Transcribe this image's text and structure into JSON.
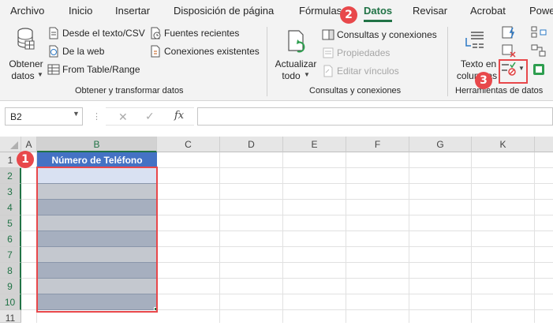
{
  "menu": {
    "tabs": [
      "Archivo",
      "Inicio",
      "Insertar",
      "Disposición de página",
      "Fórmulas",
      "Datos",
      "Revisar",
      "Acrobat",
      "Powe"
    ],
    "active_tab": "Datos"
  },
  "ribbon": {
    "get_transform": {
      "get_data_label": "Obtener",
      "get_data_label2": "datos",
      "from_text": "Desde el texto/CSV",
      "from_web": "De la web",
      "from_table": "From Table/Range",
      "recent_sources": "Fuentes recientes",
      "existing_connections": "Conexiones existentes",
      "group_label": "Obtener y transformar datos"
    },
    "queries": {
      "refresh_label": "Actualizar",
      "refresh_label2": "todo",
      "queries_connections": "Consultas y conexiones",
      "properties": "Propiedades",
      "edit_links": "Editar vínculos",
      "group_label": "Consultas y conexiones"
    },
    "data_tools": {
      "text_to_columns": "Texto en",
      "text_to_columns2": "columnas",
      "group_label": "Herramientas de datos"
    }
  },
  "formula_bar": {
    "name_box": "B2",
    "fx": "fx",
    "formula_value": ""
  },
  "sheet": {
    "columns": [
      "A",
      "B",
      "C",
      "D",
      "E",
      "F",
      "G",
      "K"
    ],
    "rows": [
      "1",
      "2",
      "3",
      "4",
      "5",
      "6",
      "7",
      "8",
      "9",
      "10",
      "11"
    ],
    "header_cell": "Número de Teléfono",
    "selected_cell": "B2",
    "selected_range": "B2:B10"
  },
  "annotations": {
    "badge1": "1",
    "badge2": "2",
    "badge3": "3",
    "color": "#e8484b"
  },
  "colors": {
    "excel_green": "#217346",
    "header_blue": "#4472c4",
    "band_dark": "#a6afbf",
    "band_light": "#c4c8cf",
    "selected_cell_bg": "#d9e1f2"
  }
}
